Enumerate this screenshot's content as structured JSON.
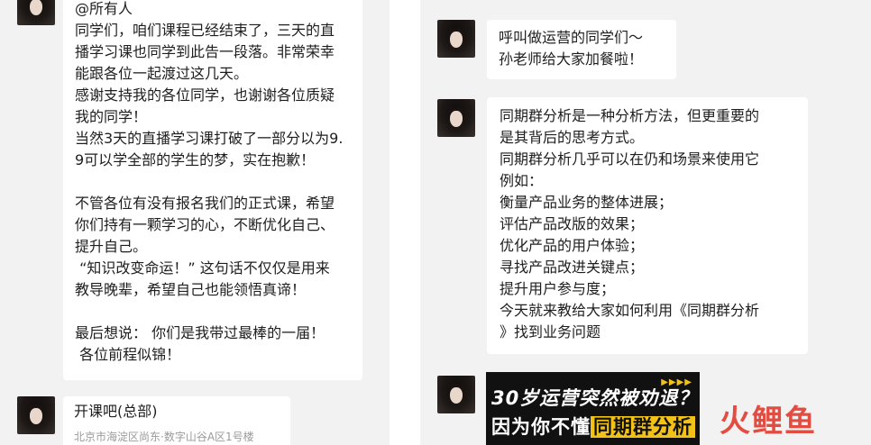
{
  "left_chat": {
    "message_lines": [
      "@所有人",
      "同学们，咱们课程已经结束了，三天的直",
      "播学习课也同学到此告一段落。非常荣幸",
      "能跟各位一起渡过这几天。",
      "感谢支持我的各位同学，也谢谢各位质疑",
      "我的同学！",
      "当然3天的直播学习课打破了一部分以为9.",
      "9可以学全部的学生的梦，实在抱歉！",
      "",
      "不管各位有没有报名我们的正式课，希望",
      "你们持有一颗学习的心，不断优化自己、",
      "提升自己。",
      " “知识改变命运！” 这句话不仅仅是用来",
      "教导晚辈，希望自己也能领悟真谛！",
      "",
      "最后想说： 你们是我带过最棒的一届！",
      " 各位前程似锦！"
    ],
    "card": {
      "name": "开课吧(总部)",
      "address": "北京市海淀区尚东·数字山谷A区1号楼"
    }
  },
  "right_chat": {
    "message1_lines": [
      "呼叫做运营的同学们～",
      "孙老师给大家加餐啦！"
    ],
    "message2_lines": [
      "同期群分析是一种分析方法，但更重要的",
      "是其背后的思考方式。",
      "同期群分析几乎可以在仍和场景来使用它",
      "例如：",
      "衡量产品业务的整体进展；",
      "评估产品改版的效果；",
      "优化产品的用户体验；",
      "寻找产品改进关键点；",
      "提升用户参与度；",
      "今天就来教给大家如何利用《同期群分析",
      "》找到业务问题"
    ],
    "banner": {
      "line1": "30岁运营突然被劝退？",
      "line2_plain": "因为你不懂",
      "line2_highlight": "同期群分析",
      "dots": "▶▶▶▶"
    }
  },
  "watermark": {
    "text": [
      "火",
      "鲤",
      "鱼"
    ],
    "color": "#e23b2e"
  },
  "colors": {
    "chat_background": "#f2f2f2",
    "bubble": "#ffffff",
    "banner_highlight": "#f2c219"
  }
}
